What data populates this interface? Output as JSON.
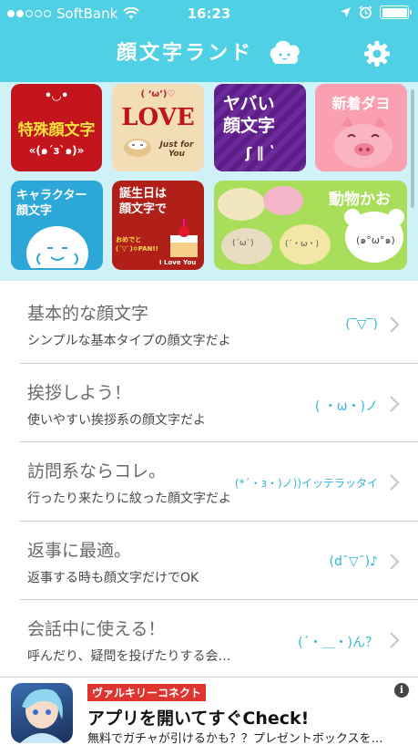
{
  "status": {
    "carrier": "SoftBank",
    "time": "16:23",
    "signal_bars_filled": 2,
    "signal_bars_total": 5
  },
  "header": {
    "title": "顔文字ランド",
    "settings_icon": "gear-icon"
  },
  "banners": [
    {
      "label": "特殊顔文字",
      "caption": "«(๑´з`๑)»",
      "deco": "•◡•",
      "color": "#c2151c"
    },
    {
      "label": "LOVE",
      "caption": "Just for You",
      "deco": "( ‘ω’)♡",
      "color": "#f2ddb7"
    },
    {
      "label": "ヤバい顔文字",
      "caption": "ʃ ∥ ʽ",
      "color": "#5b1e86"
    },
    {
      "label": "新着ダヨ",
      "color": "#fba0b0"
    },
    {
      "label": "キャラクター顔文字",
      "color": "#2ca7d8"
    },
    {
      "label": "誕生日は顔文字で",
      "caption": "おめでと(´▽`)✡PAN!!",
      "caption2": "I Love You",
      "color": "#b02018"
    },
    {
      "label": "動物かお",
      "face1": "(´ω`)",
      "face2": "(´・ω・)",
      "face3": "(๑°ω°๑)",
      "color": "#a9de5a"
    }
  ],
  "list": [
    {
      "title": "基本的な顔文字",
      "subtitle": "シンプルな基本タイプの顔文字だよ",
      "kaomoji": "(‾▽‾)"
    },
    {
      "title": "挨拶しよう！",
      "subtitle": "使いやすい挨拶系の顔文字だよ",
      "kaomoji": "( ・ω・)ノ"
    },
    {
      "title": "訪問系ならコレ。",
      "subtitle": "行ったり来たりに紋った顔文字だよ",
      "kaomoji": "(*´・з・)ノ))イッテラッタイ"
    },
    {
      "title": "返事に最適。",
      "subtitle": "返事する時も顔文字だけでOK",
      "kaomoji": "(d¯▽¯)♪"
    },
    {
      "title": "会話中に使える！",
      "subtitle": "呼んだり、疑問を投げたりする会…",
      "kaomoji": "(´・＿・)ん？"
    }
  ],
  "ad": {
    "brand": "ヴァルキリーコネクト",
    "headline": "アプリを開いてすぐCheck!",
    "body": "無料でガチャが引けるかも？？プレゼントボックスを…",
    "info_label": "i"
  },
  "colors": {
    "accent": "#4fd0e4",
    "kaomoji": "#2fb6d9",
    "banner_bg": "#cff1f8"
  }
}
